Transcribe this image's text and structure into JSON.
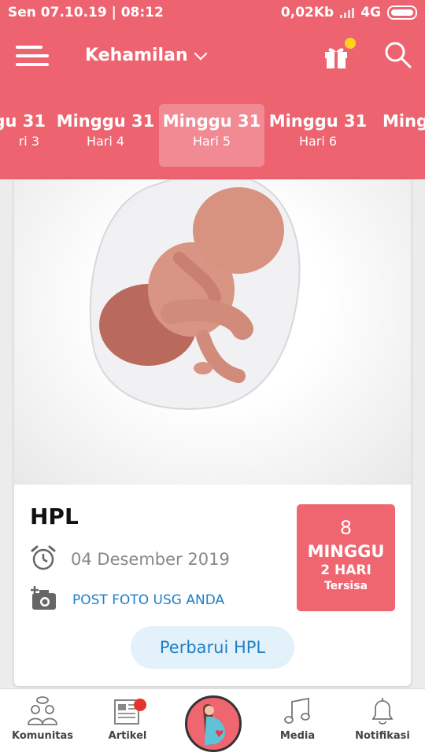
{
  "status_bar": {
    "datetime": "Sen 07.10.19 | 08:12",
    "network_speed": "0,02Kb",
    "network_type": "4G"
  },
  "app_bar": {
    "title": "Kehamilan"
  },
  "weeks": [
    {
      "week": "gu 31",
      "day": "ri 3"
    },
    {
      "week": "Minggu 31",
      "day": "Hari 4"
    },
    {
      "week": "Minggu 31",
      "day": "Hari 5",
      "active": true
    },
    {
      "week": "Minggu 31",
      "day": "Hari 6"
    },
    {
      "week": "Mingg",
      "day": ""
    }
  ],
  "card": {
    "hpl_label": "HPL",
    "due_date": "04 Desember 2019",
    "post_usg": "POST FOTO USG ANDA",
    "countdown": {
      "number": "8",
      "unit": "MINGGU",
      "days": "2 HARI",
      "remaining": "Tersisa"
    },
    "update_button": "Perbarui HPL"
  },
  "bottom_nav": {
    "items": [
      "Komunitas",
      "Artikel",
      "Media",
      "Notifikasi"
    ]
  },
  "colors": {
    "primary": "#ee6370",
    "link": "#1f7fc7",
    "badge": "#e5342b",
    "gift_dot": "#ffd21f"
  }
}
